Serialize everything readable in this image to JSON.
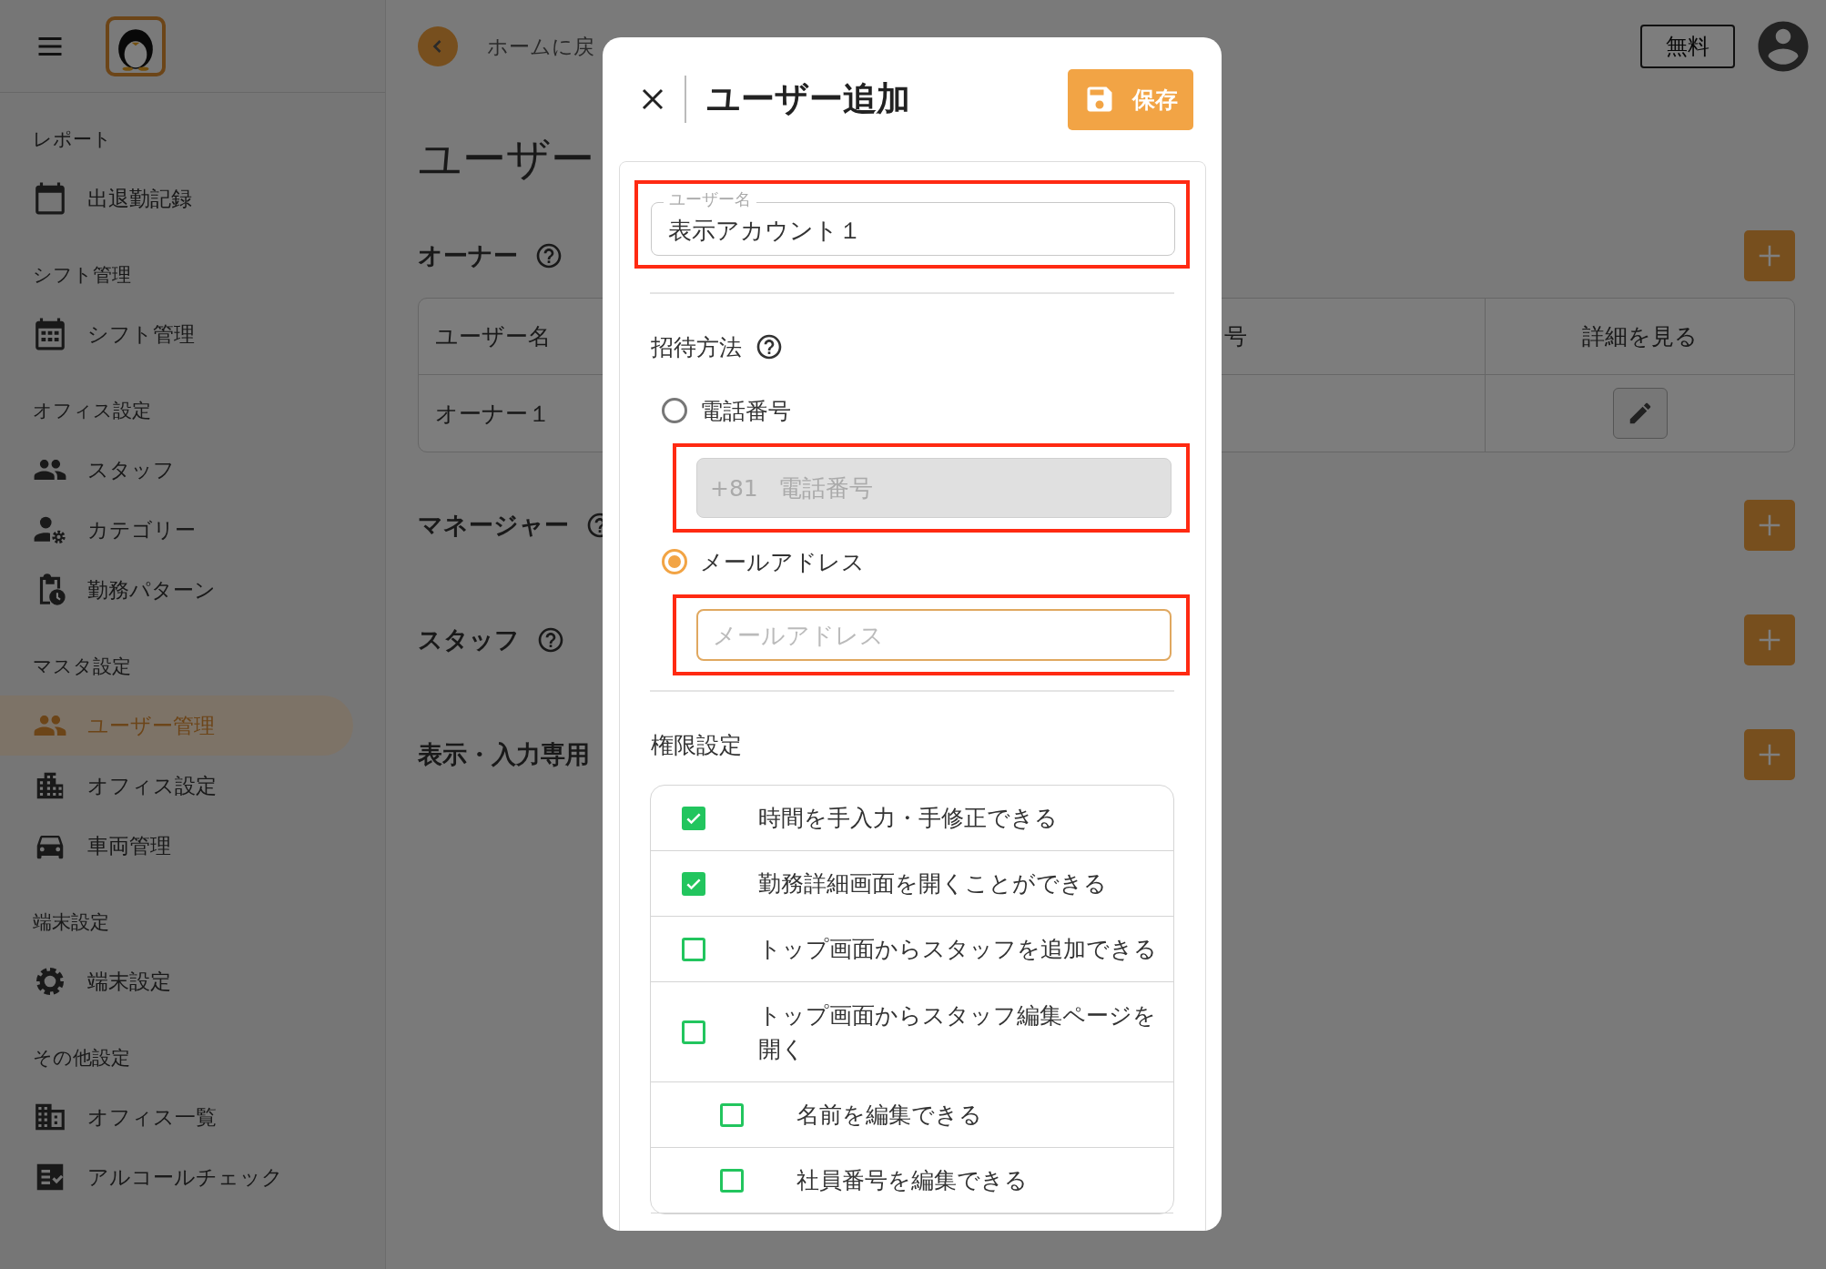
{
  "sidebar": {
    "sections": [
      {
        "title": "レポート",
        "items": [
          {
            "label": "出退勤記録",
            "selected": false
          }
        ]
      },
      {
        "title": "シフト管理",
        "items": [
          {
            "label": "シフト管理",
            "selected": false
          }
        ]
      },
      {
        "title": "オフィス設定",
        "items": [
          {
            "label": "スタッフ",
            "selected": false
          },
          {
            "label": "カテゴリー",
            "selected": false
          },
          {
            "label": "勤務パターン",
            "selected": false
          }
        ]
      },
      {
        "title": "マスタ設定",
        "items": [
          {
            "label": "ユーザー管理",
            "selected": true
          },
          {
            "label": "オフィス設定",
            "selected": false
          },
          {
            "label": "車両管理",
            "selected": false
          }
        ]
      },
      {
        "title": "端末設定",
        "items": [
          {
            "label": "端末設定",
            "selected": false
          }
        ]
      },
      {
        "title": "その他設定",
        "items": [
          {
            "label": "オフィス一覧",
            "selected": false
          },
          {
            "label": "アルコールチェック",
            "selected": false
          }
        ]
      }
    ]
  },
  "header": {
    "back_label": "ホームに戻",
    "plan_button": "無料"
  },
  "page_title": "ユーザー",
  "sections": [
    {
      "title": "オーナー",
      "help": true,
      "table": {
        "columns": [
          "ユーザー名",
          "号",
          "詳細を見る"
        ],
        "rows": [
          {
            "cells": [
              "オーナー１"
            ]
          }
        ]
      }
    },
    {
      "title": "マネージャー",
      "help": true
    },
    {
      "title": "スタッフ",
      "help": true
    },
    {
      "title": "表示・入力専用",
      "help": false
    }
  ],
  "dialog": {
    "title": "ユーザー追加",
    "save_button": "保存",
    "username_field": {
      "label": "ユーザー名",
      "value": "表示アカウント１",
      "highlighted": true
    },
    "invite": {
      "title": "招待方法",
      "options": [
        {
          "label": "電話番号",
          "selected": false,
          "field": {
            "prefix": "+81",
            "placeholder": "電話番号",
            "disabled": true,
            "highlighted": true
          }
        },
        {
          "label": "メールアドレス",
          "selected": true,
          "field": {
            "placeholder": "メールアドレス",
            "disabled": false,
            "highlighted": true
          }
        }
      ]
    },
    "permissions": {
      "title": "権限設定",
      "items": [
        {
          "label": "時間を手入力・手修正できる",
          "checked": true
        },
        {
          "label": "勤務詳細画面を開くことができる",
          "checked": true
        },
        {
          "label": "トップ画面からスタッフを追加できる",
          "checked": false
        },
        {
          "label": "トップ画面からスタッフ編集ページを開く",
          "checked": false,
          "children": [
            {
              "label": "名前を編集できる",
              "checked": false
            },
            {
              "label": "社員番号を編集できる",
              "checked": false
            }
          ]
        }
      ]
    }
  }
}
